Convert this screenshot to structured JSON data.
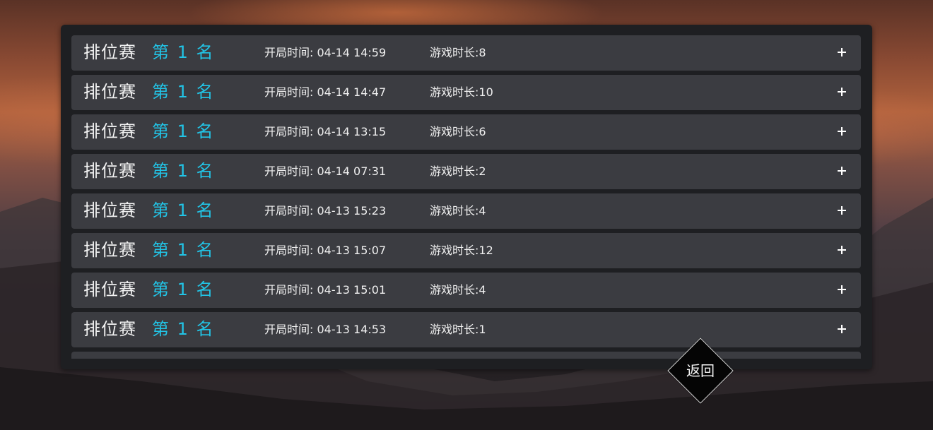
{
  "records": [
    {
      "mode": "排位赛",
      "rank": "第 1 名",
      "start": "开局时间: 04-14 14:59",
      "duration": "游戏时长:8"
    },
    {
      "mode": "排位赛",
      "rank": "第 1 名",
      "start": "开局时间: 04-14 14:47",
      "duration": "游戏时长:10"
    },
    {
      "mode": "排位赛",
      "rank": "第 1 名",
      "start": "开局时间: 04-14 13:15",
      "duration": "游戏时长:6"
    },
    {
      "mode": "排位赛",
      "rank": "第 1 名",
      "start": "开局时间: 04-14 07:31",
      "duration": "游戏时长:2"
    },
    {
      "mode": "排位赛",
      "rank": "第 1 名",
      "start": "开局时间: 04-13 15:23",
      "duration": "游戏时长:4"
    },
    {
      "mode": "排位赛",
      "rank": "第 1 名",
      "start": "开局时间: 04-13 15:07",
      "duration": "游戏时长:12"
    },
    {
      "mode": "排位赛",
      "rank": "第 1 名",
      "start": "开局时间: 04-13 15:01",
      "duration": "游戏时长:4"
    },
    {
      "mode": "排位赛",
      "rank": "第 1 名",
      "start": "开局时间: 04-13 14:53",
      "duration": "游戏时长:1"
    }
  ],
  "back_button": {
    "label": "返回"
  },
  "icons": {
    "expand": "plus-icon"
  },
  "colors": {
    "rank_accent": "#22c4e6",
    "row_bg": "#3b3c41",
    "panel_bg": "#1e1f22"
  }
}
